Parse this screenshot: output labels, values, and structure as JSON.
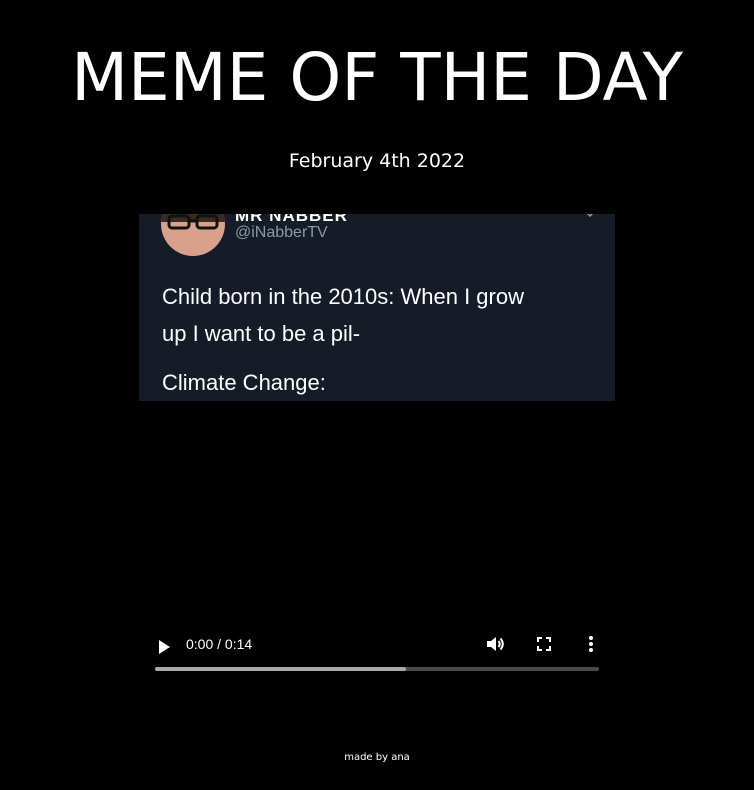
{
  "header": {
    "title": "MEME OF THE DAY",
    "date": "February 4th 2022"
  },
  "video": {
    "tweet": {
      "name": "MR NABBER",
      "handle": "@iNabberTV",
      "lines": [
        "Child born in the 2010s: When I grow",
        "up I want to be a pil-",
        "Climate Change:"
      ]
    },
    "controls": {
      "time": "0:00 / 0:14",
      "buffered_fraction": 0.565,
      "played_fraction": 0.0,
      "play_icon": "play-icon",
      "volume_icon": "volume-icon",
      "fullscreen_icon": "fullscreen-icon",
      "more_icon": "more-vertical-icon"
    }
  },
  "footer": {
    "text": "made by ana"
  },
  "colors": {
    "background": "#000000",
    "text": "#ffffff",
    "tweet_background": "#151c28",
    "handle": "#8899a6"
  }
}
